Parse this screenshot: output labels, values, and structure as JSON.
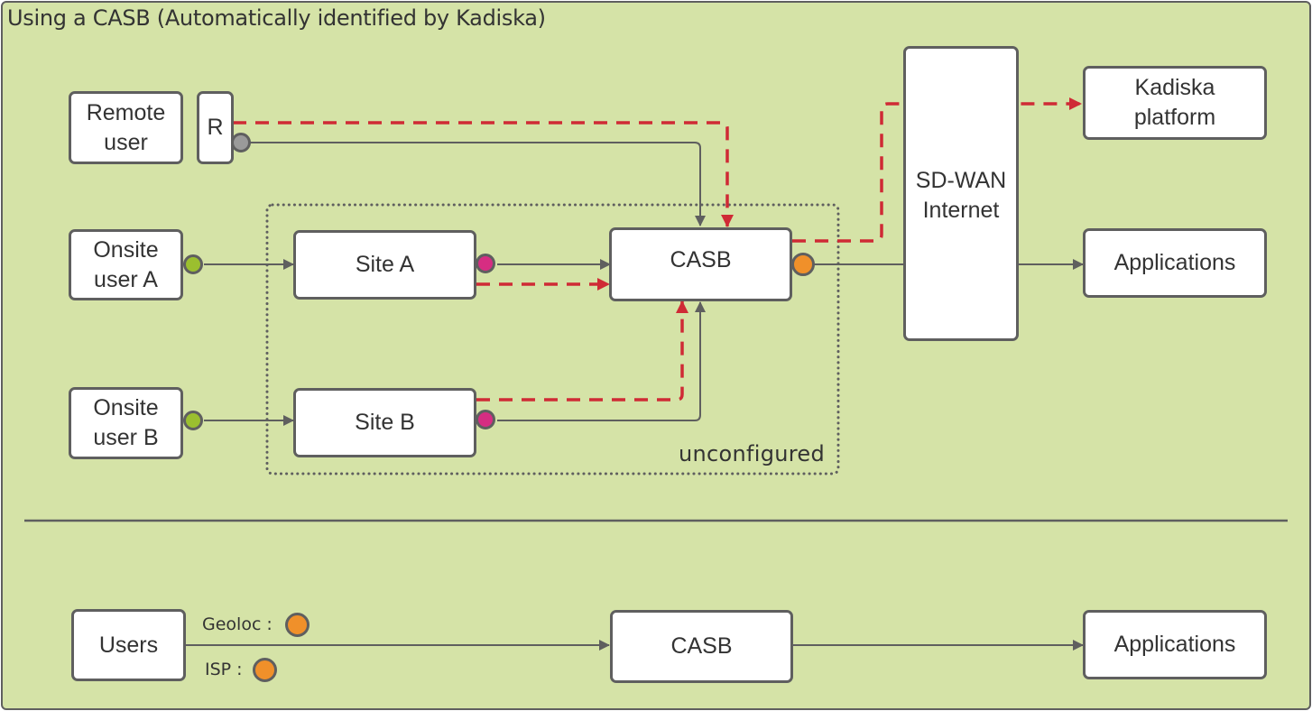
{
  "title": "Using a CASB (Automatically identified by Kadiska)",
  "colors": {
    "background": "#d5e3a7",
    "box_fill": "#ffffff",
    "stroke": "#5f5f5f",
    "dashed_path": "#cf2a35",
    "user_dot": "#9bbf2f",
    "site_dot": "#d62d82",
    "remote_dot": "#9a9a9a",
    "casb_dot": "#f0902a"
  },
  "top_diagram": {
    "nodes": {
      "remote_user": "Remote\nuser",
      "remote_agent": "R",
      "onsite_user_a": "Onsite\nuser A",
      "onsite_user_b": "Onsite\nuser B",
      "site_a": "Site A",
      "site_b": "Site B",
      "casb": "CASB",
      "sdwan": "SD-WAN\nInternet",
      "kadiska": "Kadiska\nplatform",
      "applications": "Applications"
    },
    "group_label": "unconfigured"
  },
  "legend_diagram": {
    "users": "Users",
    "geoloc_label": "Geoloc :",
    "isp_label": "ISP :",
    "casb": "CASB",
    "applications": "Applications"
  }
}
